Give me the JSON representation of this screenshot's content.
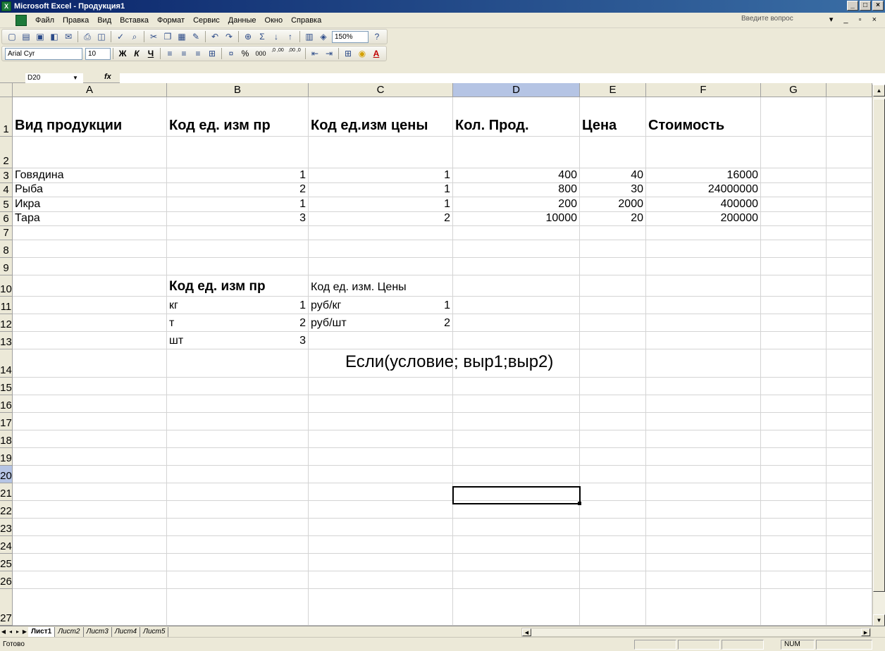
{
  "window": {
    "title": "Microsoft Excel - Продукция1",
    "minimize": "_",
    "maximize": "□",
    "close": "×"
  },
  "menu": {
    "items": [
      "Файл",
      "Правка",
      "Вид",
      "Вставка",
      "Формат",
      "Сервис",
      "Данные",
      "Окно",
      "Справка"
    ],
    "help_placeholder": "Введите вопрос",
    "mdi_buttons": "▾ _ ▫ ×"
  },
  "toolbar": {
    "zoom": "150%",
    "font": "Arial Cyr",
    "size": "10",
    "bold": "Ж",
    "italic": "К",
    "underline": "Ч",
    "percent": "%",
    "thousands": "000",
    "inc_decimal": ",0 ,00",
    "dec_decimal": ",00 ,0"
  },
  "formula": {
    "namebox": "D20",
    "fx": "fx",
    "value": ""
  },
  "columns": [
    "A",
    "B",
    "C",
    "D",
    "E",
    "F",
    "G"
  ],
  "rows": [
    "1",
    "2",
    "3",
    "4",
    "5",
    "6",
    "7",
    "8",
    "9",
    "10",
    "11",
    "12",
    "13",
    "14",
    "15",
    "16",
    "17",
    "18",
    "19",
    "20",
    "21",
    "22",
    "23",
    "24",
    "25",
    "26",
    "27"
  ],
  "cells": {
    "A1": "Вид продукции",
    "B1": "Код ед. изм пр",
    "C1": "Код ед.изм цены",
    "D1": "Кол. Прод.",
    "E1": "Цена",
    "F1": "Стоимость",
    "A3": "Говядина",
    "B3": "1",
    "C3": "1",
    "D3": "400",
    "E3": "40",
    "F3": "16000",
    "A4": "Рыба",
    "B4": "2",
    "C4": "1",
    "D4": "800",
    "E4": "30",
    "F4": "24000000",
    "A5": "Икра",
    "B5": "1",
    "C5": "1",
    "D5": "200",
    "E5": "2000",
    "F5": "400000",
    "A6": "Тара",
    "B6": "3",
    "C6": "2",
    "D6": "10000",
    "E6": "20",
    "F6": "200000",
    "B10": "Код ед. изм пр",
    "C10": "Код ед. изм. Цены",
    "B11_label": "кг",
    "B11_val": "1",
    "B12_label": "т",
    "B12_val": "2",
    "B13_label": "шт",
    "B13_val": "3",
    "C11_label": "руб/кг",
    "C11_val": "1",
    "C12_label": "руб/шт",
    "C12_val": "2",
    "C14": "Если(условие; выр1;выр2)"
  },
  "sheets": [
    "Лист1",
    "Лист2",
    "Лист3",
    "Лист4",
    "Лист5"
  ],
  "status": {
    "ready": "Готово",
    "num": "NUM"
  }
}
